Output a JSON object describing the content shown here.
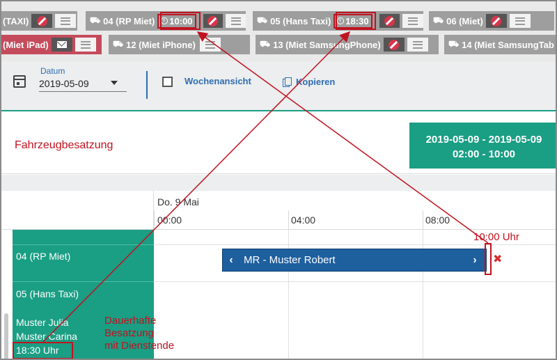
{
  "chips": {
    "row1": [
      {
        "label": "(TAXI)"
      },
      {
        "label": "04 (RP Miet)",
        "time": "10:00"
      },
      {
        "label": "05 (Hans Taxi)",
        "time": "18:30"
      },
      {
        "label": "06 (Miet)"
      }
    ],
    "row2": [
      {
        "label": "(Miet iPad)"
      },
      {
        "label": "12 (Miet iPhone)"
      },
      {
        "label": "13 (Miet SamsungPhone)"
      },
      {
        "label": "14 (Miet SamsungTab"
      }
    ]
  },
  "toolbar": {
    "date_label": "Datum",
    "date_value": "2019-05-09",
    "week_view_label": "Wochenansicht",
    "copy_label": "Kopieren"
  },
  "heading": {
    "title": "Fahrzeugbesatzung",
    "date_range": "2019-05-09 - 2019-05-09",
    "time_range": "02:00 - 10:00"
  },
  "timeline": {
    "day_label": "Do. 9 Mai",
    "hours": [
      "00:00",
      "04:00",
      "08:00"
    ]
  },
  "resources": {
    "row1": "04 (RP Miet)",
    "row2": "05 (Hans Taxi)",
    "member1": "Muster Julia",
    "member2": "Muster Carina",
    "end_time": "18:30 Uhr"
  },
  "event": {
    "label": "MR - Muster Robert"
  },
  "annotations": {
    "end_marker": "10:00 Uhr",
    "note_line1": "Dauerhafte",
    "note_line2": "Besatzung",
    "note_line3": "mit Dienstende",
    "color": "#c1121f"
  },
  "colors": {
    "accent_green": "#1a9e84",
    "event_blue": "#1e5f9e",
    "chip_gray": "#9e9e9e",
    "chip_pink": "#c44b5b"
  }
}
